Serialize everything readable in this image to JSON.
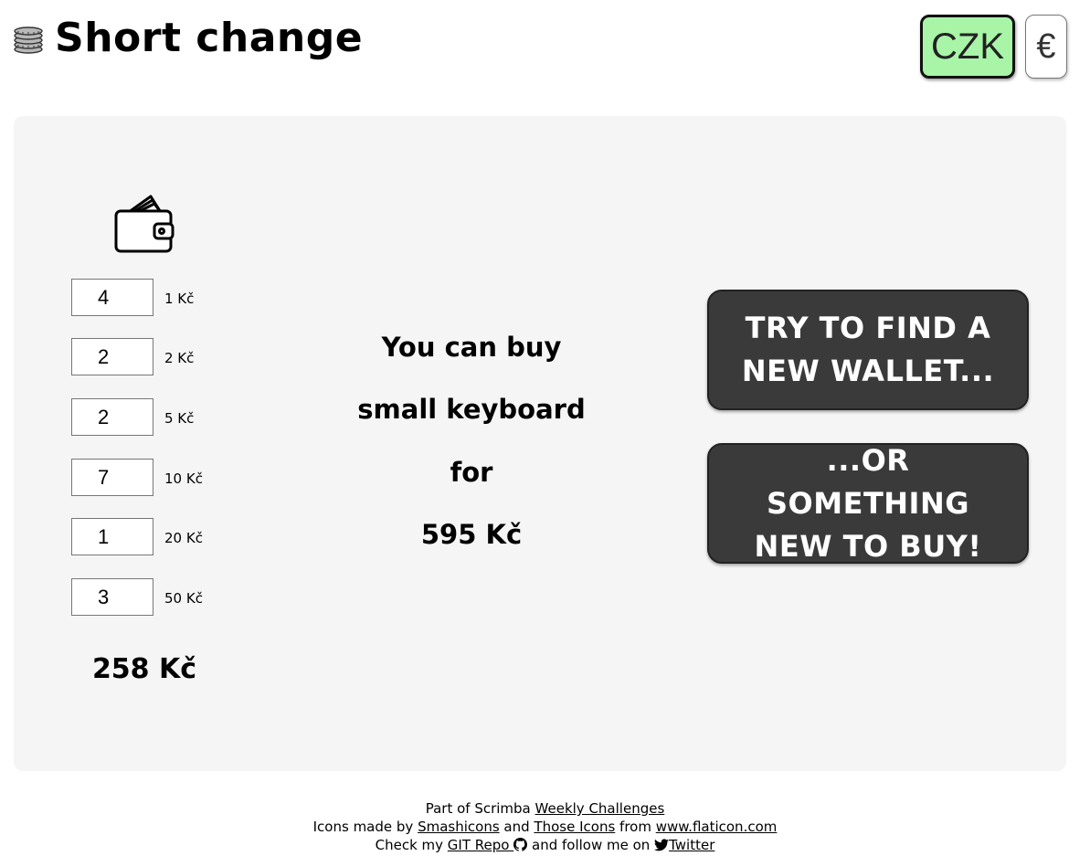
{
  "header": {
    "title": "Short change",
    "logo_icon": "coins-icon",
    "currency_buttons": [
      {
        "label": "CZK",
        "active": true
      },
      {
        "label": "€",
        "active": false
      }
    ]
  },
  "wallet": {
    "icon": "wallet-icon",
    "coins": [
      {
        "count": "4",
        "label": "1 Kč"
      },
      {
        "count": "2",
        "label": "2 Kč"
      },
      {
        "count": "2",
        "label": "5 Kč"
      },
      {
        "count": "7",
        "label": "10 Kč"
      },
      {
        "count": "1",
        "label": "20 Kč"
      },
      {
        "count": "3",
        "label": "50 Kč"
      }
    ],
    "total": "258 Kč"
  },
  "result": {
    "line1": "You can buy",
    "item": "small keyboard",
    "line3": "for",
    "price": "595 Kč"
  },
  "actions": {
    "find_wallet": "TRY TO FIND A NEW WALLET...",
    "new_item": "...OR SOMETHING NEW TO BUY!"
  },
  "footer": {
    "line1_prefix": "Part of Scrimba",
    "line1_link": "Weekly Challenges",
    "line2_prefix": "Icons made by",
    "line2_link1": "Smashicons",
    "line2_and": "and",
    "line2_link2": "Those Icons",
    "line2_from": "from",
    "line2_link3": "www.flaticon.com",
    "line3_prefix": "Check my",
    "line3_link1": "GIT Repo",
    "line3_mid": "and follow me on",
    "line3_link2": "Twitter"
  },
  "colors": {
    "active_currency": "#a8f5a8",
    "card_background": "#f5f5f5",
    "action_button": "#3a3a3a"
  }
}
